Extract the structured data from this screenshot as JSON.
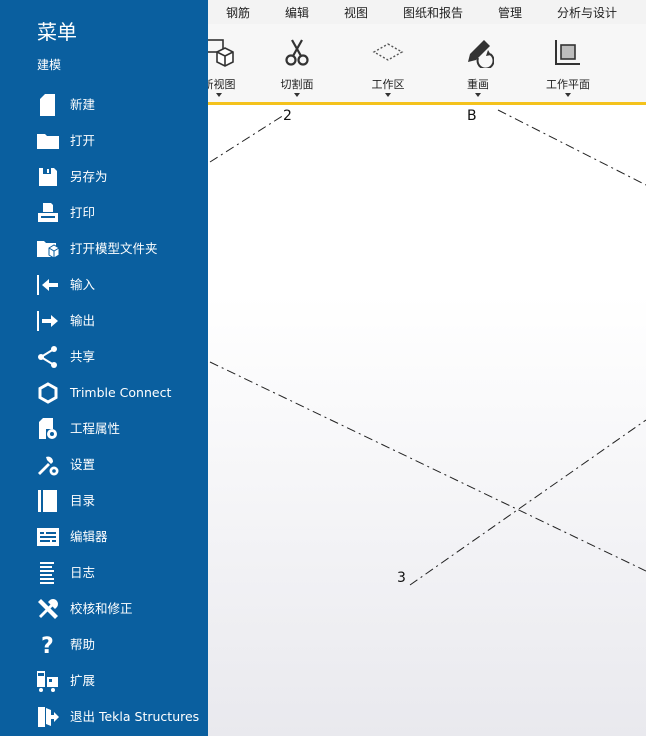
{
  "menu": {
    "title": "菜单",
    "subtitle": "建模",
    "items": [
      {
        "label": "新建",
        "icon": "new-file-icon"
      },
      {
        "label": "打开",
        "icon": "folder-icon"
      },
      {
        "label": "另存为",
        "icon": "save-icon"
      },
      {
        "label": "打印",
        "icon": "print-icon"
      },
      {
        "label": "打开模型文件夹",
        "icon": "model-folder-icon"
      },
      {
        "label": "输入",
        "icon": "import-icon"
      },
      {
        "label": "输出",
        "icon": "export-icon"
      },
      {
        "label": "共享",
        "icon": "share-icon"
      },
      {
        "label": "Trimble Connect",
        "icon": "trimble-connect-icon"
      },
      {
        "label": "工程属性",
        "icon": "project-properties-icon"
      },
      {
        "label": "设置",
        "icon": "settings-icon"
      },
      {
        "label": "目录",
        "icon": "catalog-icon"
      },
      {
        "label": "编辑器",
        "icon": "editor-icon"
      },
      {
        "label": "日志",
        "icon": "log-icon"
      },
      {
        "label": "校核和修正",
        "icon": "check-fix-icon"
      },
      {
        "label": "帮助",
        "icon": "help-icon"
      },
      {
        "label": "扩展",
        "icon": "extensions-icon"
      },
      {
        "label": "退出 Tekla Structures",
        "icon": "exit-icon"
      }
    ]
  },
  "ribbon": {
    "tabs": [
      "钢筋",
      "编辑",
      "视图",
      "图纸和报告",
      "管理",
      "分析与设计"
    ],
    "active_tab": "视图",
    "tools": [
      {
        "label": "新视图",
        "icon": "new-view-icon"
      },
      {
        "label": "切割面",
        "icon": "scissors-icon"
      },
      {
        "label": "工作区",
        "icon": "work-area-icon"
      },
      {
        "label": "重画",
        "icon": "redraw-icon"
      },
      {
        "label": "工作平面",
        "icon": "work-plane-icon"
      }
    ]
  },
  "viewport": {
    "grid_labels": [
      "2",
      "B",
      "3"
    ]
  },
  "colors": {
    "menu_bg": "#0a5f9f",
    "accent": "#0a5f9f",
    "toolbar_border": "#f4c21c"
  }
}
